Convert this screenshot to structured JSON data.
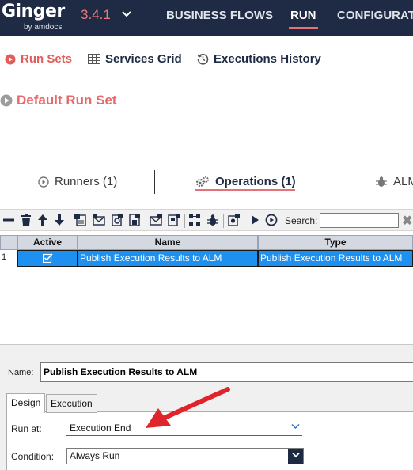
{
  "header": {
    "logo": "Ginger",
    "logo_sub": "by amdocs",
    "version": "3.4.1",
    "nav": [
      "BUSINESS FLOWS",
      "RUN",
      "CONFIGURAT"
    ],
    "active_nav": "RUN"
  },
  "subtabs": [
    "Run Sets",
    "Services Grid",
    "Executions History"
  ],
  "runset_title": "Default Run Set",
  "runner_tabs": [
    "Runners (1)",
    "Operations (1)",
    "ALM"
  ],
  "toolbar": {
    "search_label": "Search:",
    "search_value": ""
  },
  "grid": {
    "columns": [
      "Active",
      "Name",
      "Type"
    ],
    "rows": [
      {
        "num": "1",
        "active": true,
        "name": "Publish Execution Results to ALM",
        "type": "Publish Execution Results to ALM"
      }
    ]
  },
  "details": {
    "name_label": "Name:",
    "name_value": "Publish Execution Results to ALM",
    "tabs": [
      "Design",
      "Execution"
    ],
    "run_at_label": "Run at:",
    "run_at_value": "Execution End",
    "condition_label": "Condition:",
    "condition_value": "Always Run"
  },
  "colors": {
    "accent": "#e4727b",
    "header_bg": "#1f2a44",
    "selection": "#1e90f0",
    "arrow": "#e0242c"
  }
}
